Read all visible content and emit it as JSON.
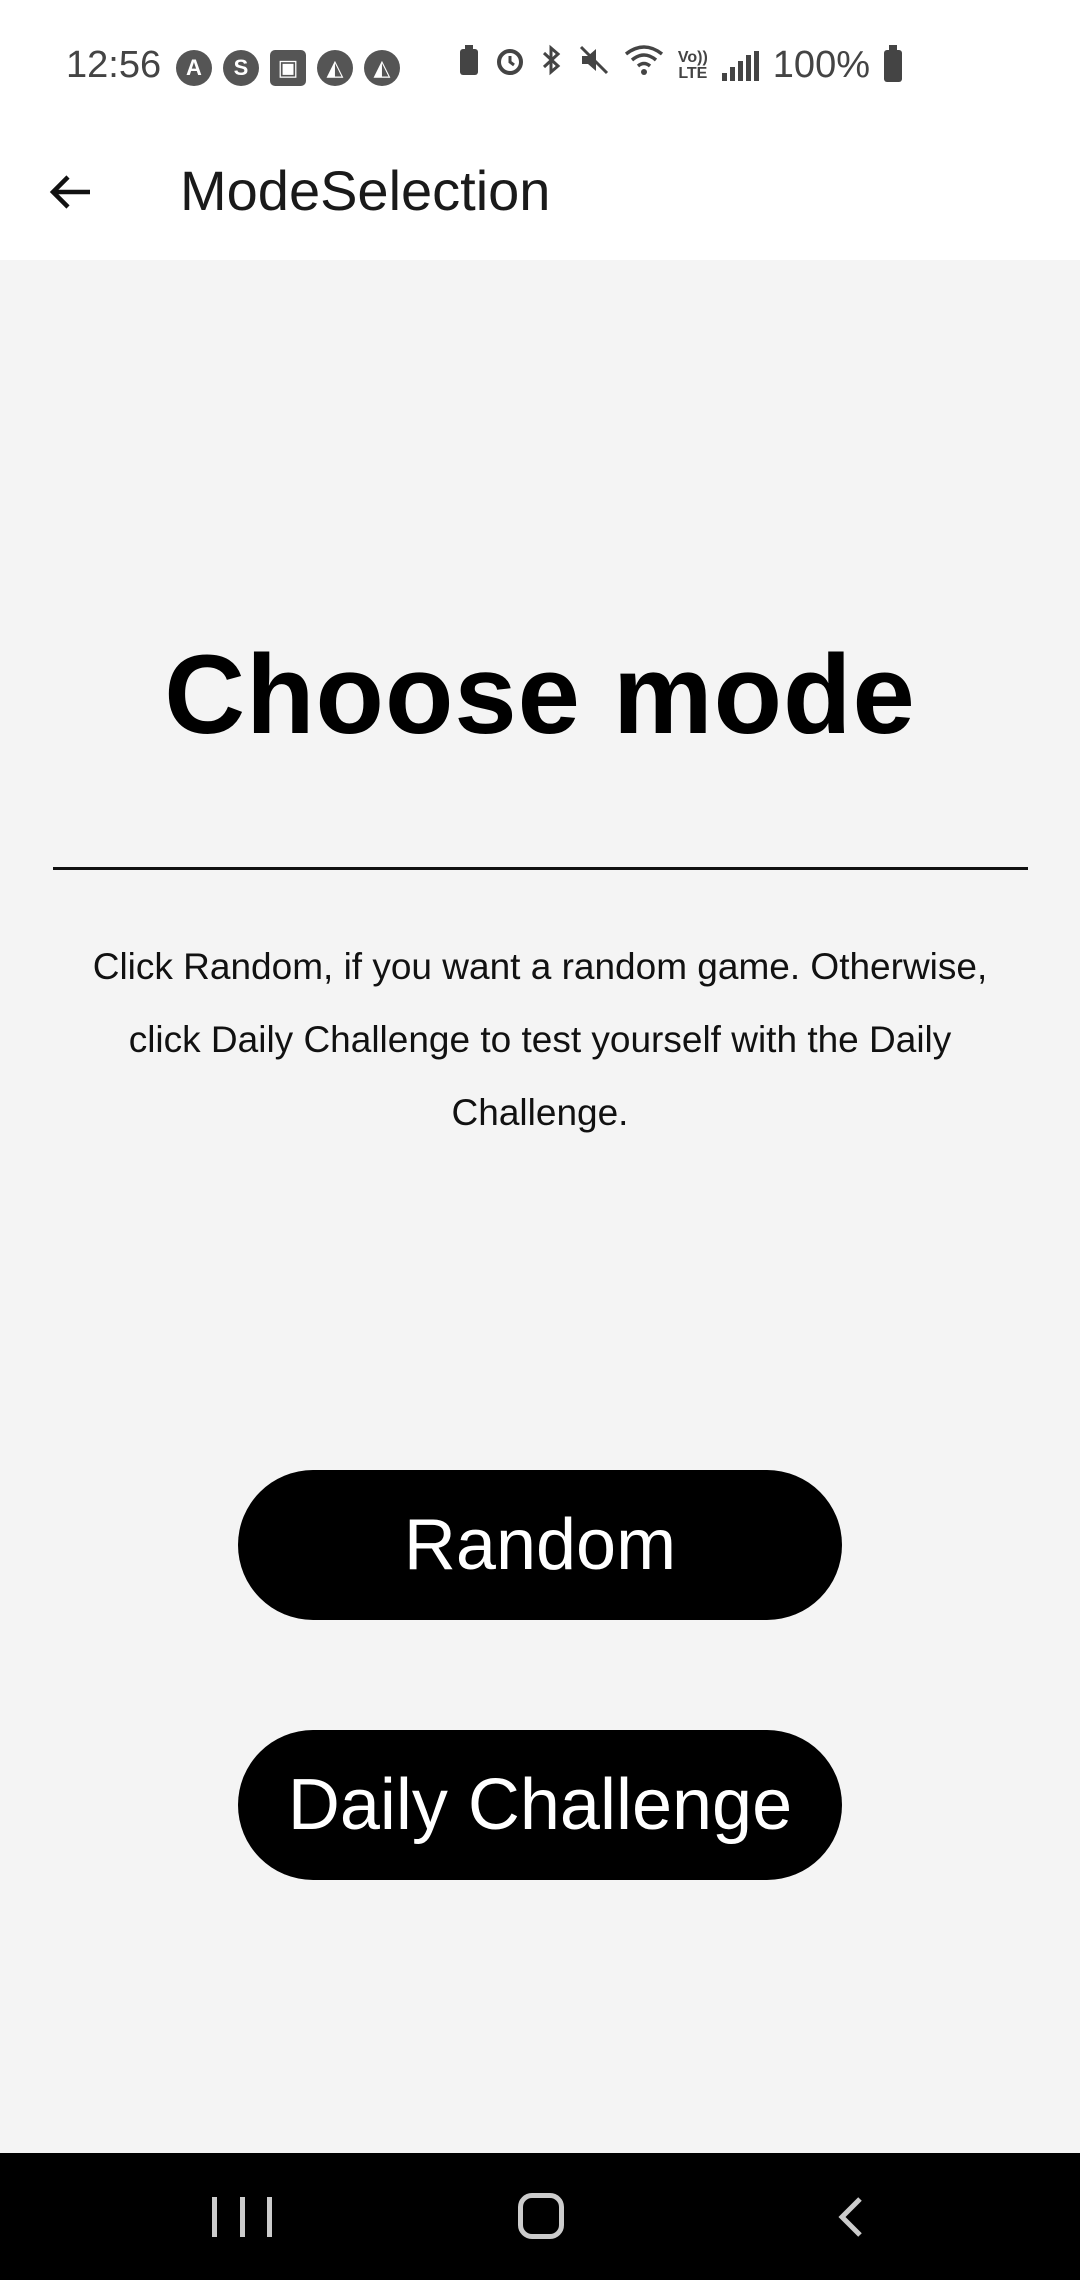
{
  "status_bar": {
    "time": "12:56",
    "left_icons": [
      "A",
      "S",
      "▣",
      "◭",
      "◭"
    ],
    "battery_text": "100%",
    "lte_top": "Vo))",
    "lte_bottom": "LTE"
  },
  "app_bar": {
    "title": "ModeSelection"
  },
  "main": {
    "heading": "Choose mode",
    "description": "Click Random, if you want a random game. Otherwise, click Daily Challenge to test yourself with the Daily Challenge.",
    "random_label": "Random",
    "daily_label": "Daily Challenge"
  },
  "colors": {
    "background": "#f4f4f4",
    "button_bg": "#000000",
    "button_text": "#ffffff"
  }
}
